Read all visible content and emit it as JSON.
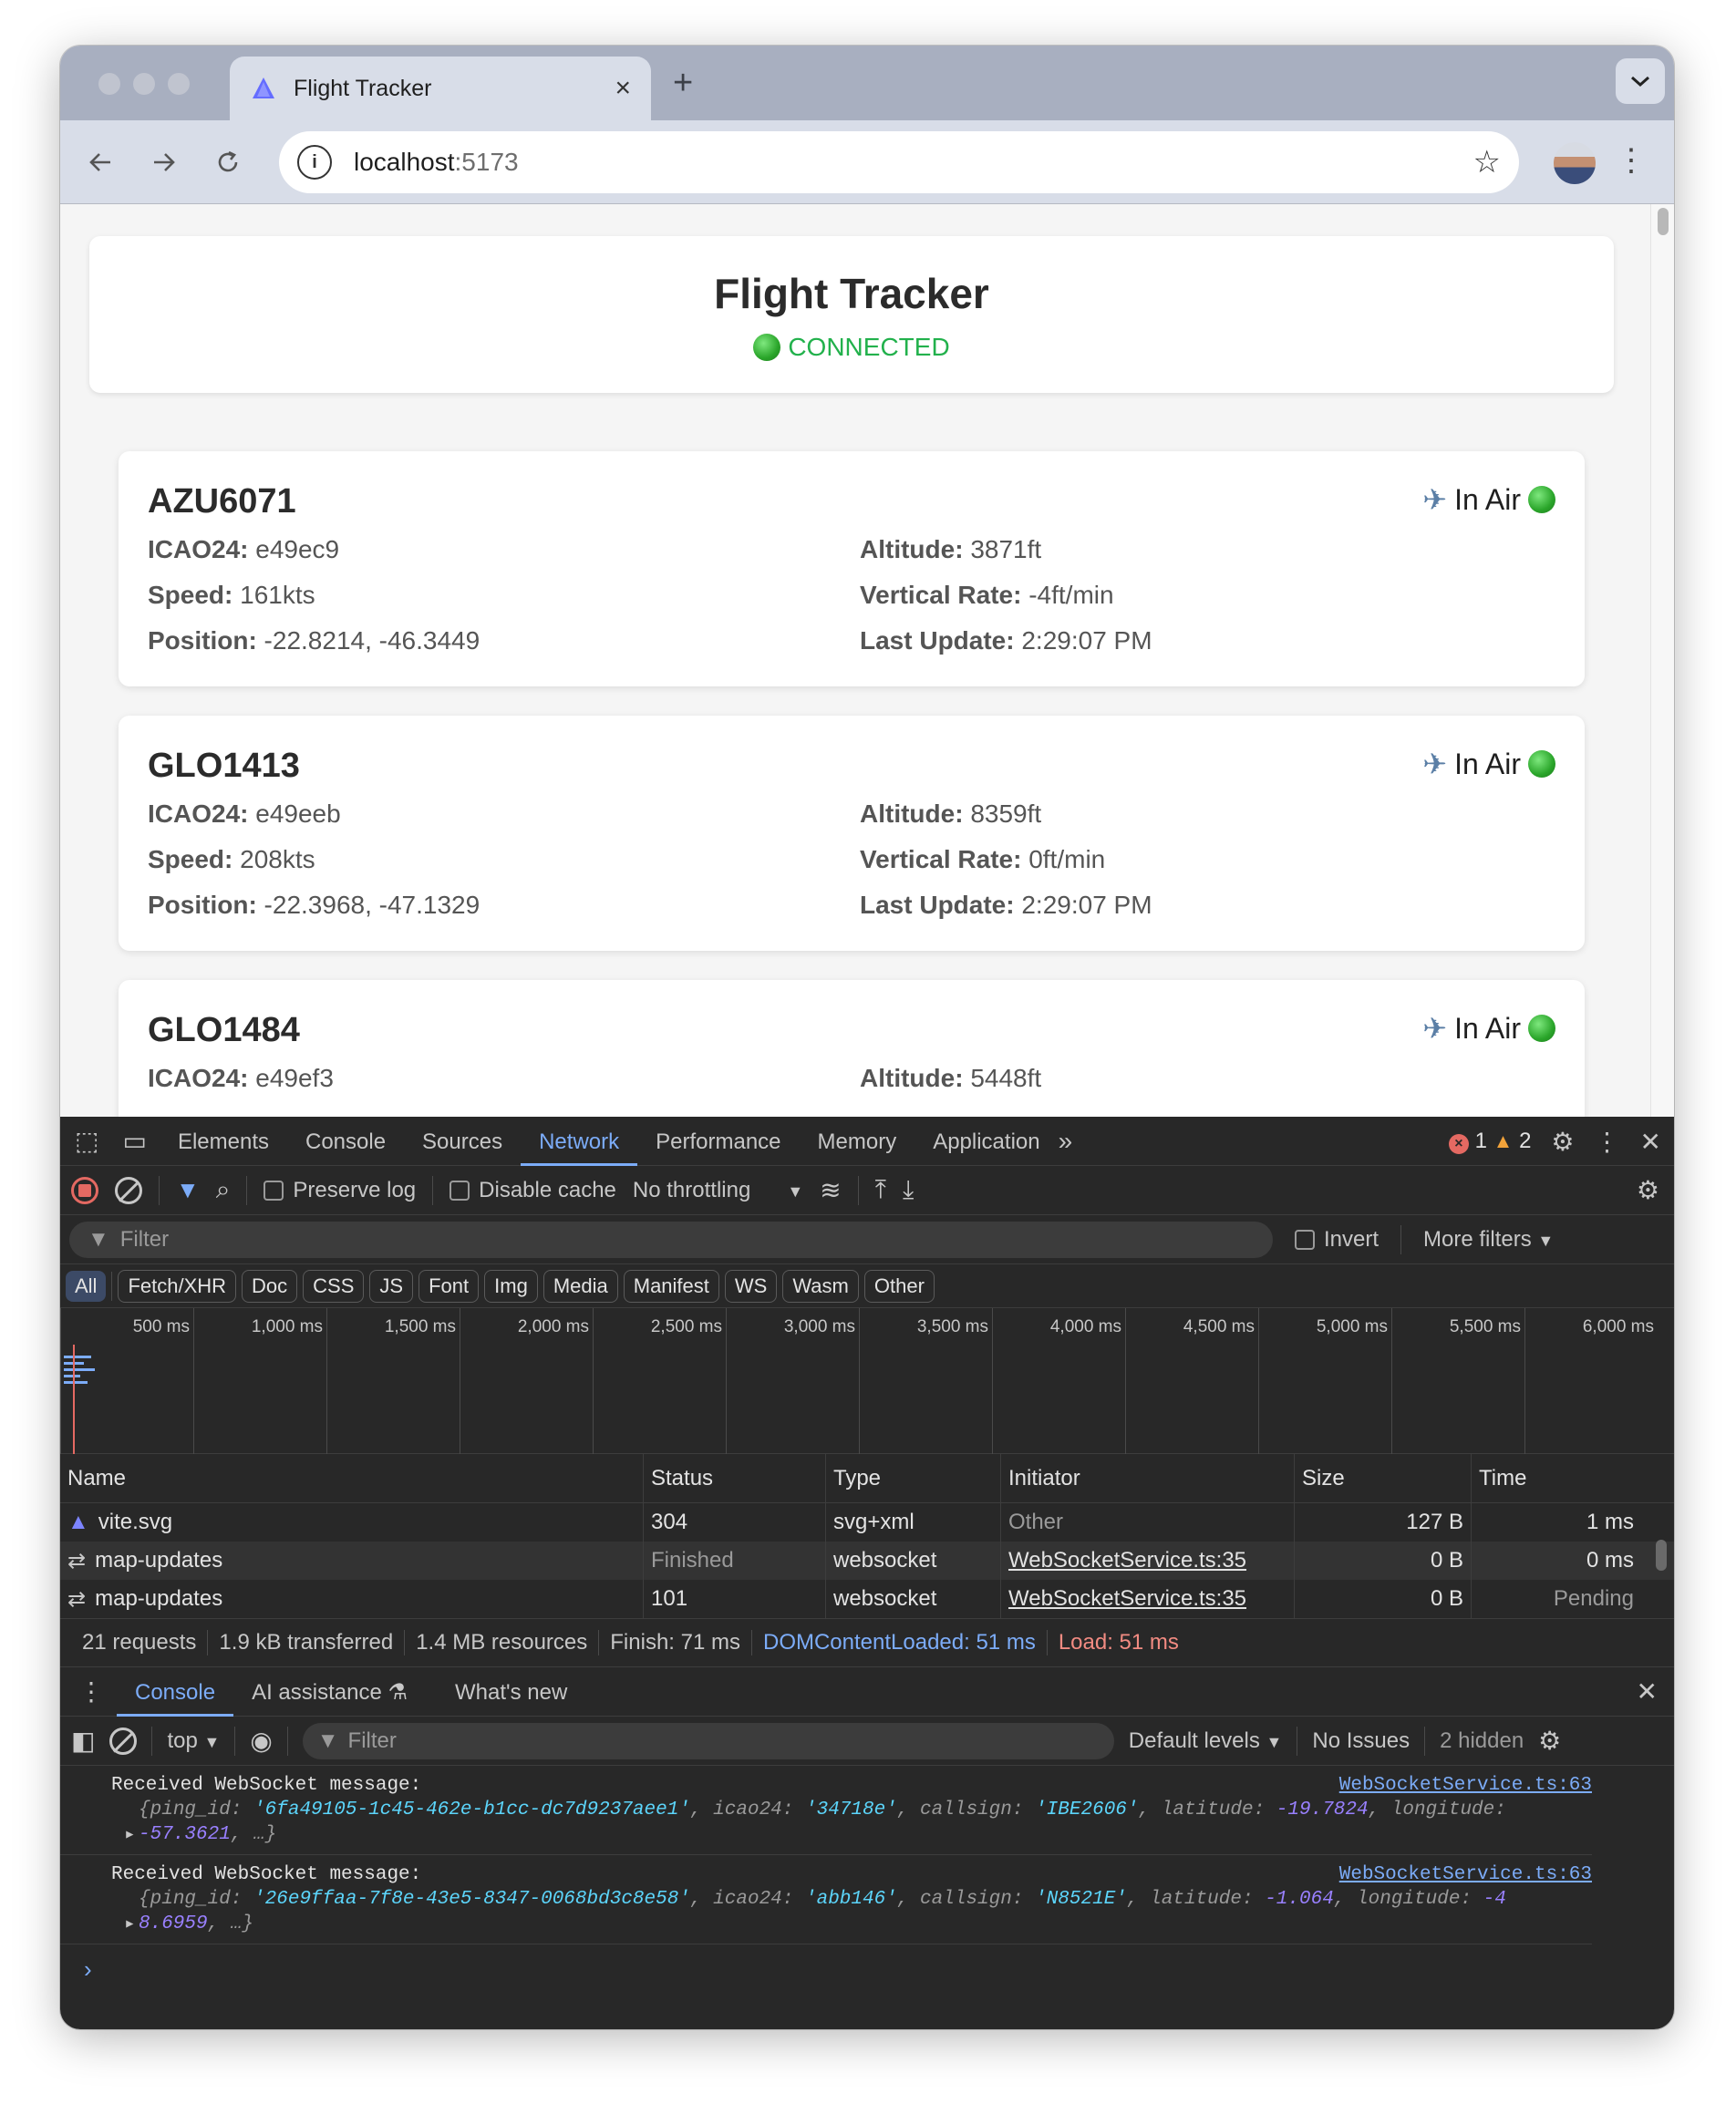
{
  "browser": {
    "tab_title": "Flight Tracker",
    "tab_close": "×",
    "new_tab": "+",
    "url_host": "localhost",
    "url_port": ":5173"
  },
  "app": {
    "title": "Flight Tracker",
    "status": "CONNECTED",
    "labels": {
      "icao24": "ICAO24:",
      "speed": "Speed:",
      "position": "Position:",
      "altitude": "Altitude:",
      "vrate": "Vertical Rate:",
      "last_update": "Last Update:"
    },
    "flights": [
      {
        "callsign": "AZU6071",
        "status": "In Air",
        "icao24": "e49ec9",
        "speed": "161kts",
        "position": "-22.8214, -46.3449",
        "altitude": "3871ft",
        "vrate": "-4ft/min",
        "last_update": "2:29:07 PM"
      },
      {
        "callsign": "GLO1413",
        "status": "In Air",
        "icao24": "e49eeb",
        "speed": "208kts",
        "position": "-22.3968, -47.1329",
        "altitude": "8359ft",
        "vrate": "0ft/min",
        "last_update": "2:29:07 PM"
      },
      {
        "callsign": "GLO1484",
        "status": "In Air",
        "icao24": "e49ef3",
        "altitude": "5448ft"
      }
    ]
  },
  "devtools": {
    "tabs": [
      "Elements",
      "Console",
      "Sources",
      "Network",
      "Performance",
      "Memory",
      "Application"
    ],
    "errors": "1",
    "warnings": "2",
    "preserve_log": "Preserve log",
    "disable_cache": "Disable cache",
    "throttling": "No throttling",
    "filter_placeholder": "Filter",
    "invert": "Invert",
    "more_filters": "More filters",
    "chips": [
      "All",
      "Fetch/XHR",
      "Doc",
      "CSS",
      "JS",
      "Font",
      "Img",
      "Media",
      "Manifest",
      "WS",
      "Wasm",
      "Other"
    ],
    "timeline_ticks": [
      "500 ms",
      "1,000 ms",
      "1,500 ms",
      "2,000 ms",
      "2,500 ms",
      "3,000 ms",
      "3,500 ms",
      "4,000 ms",
      "4,500 ms",
      "5,000 ms",
      "5,500 ms",
      "6,000 ms"
    ],
    "columns": [
      "Name",
      "Status",
      "Type",
      "Initiator",
      "Size",
      "Time"
    ],
    "rows": [
      {
        "name": "vite.svg",
        "status": "304",
        "type": "svg+xml",
        "initiator": "Other",
        "size": "127 B",
        "time": "1 ms"
      },
      {
        "name": "map-updates",
        "status": "Finished",
        "type": "websocket",
        "initiator": "WebSocketService.ts:35",
        "size": "0 B",
        "time": "0 ms"
      },
      {
        "name": "map-updates",
        "status": "101",
        "type": "websocket",
        "initiator": "WebSocketService.ts:35",
        "size": "0 B",
        "time": "Pending"
      }
    ],
    "summary": {
      "requests": "21 requests",
      "transferred": "1.9 kB transferred",
      "resources": "1.4 MB resources",
      "finish": "Finish: 71 ms",
      "dcl": "DOMContentLoaded: 51 ms",
      "load": "Load: 51 ms"
    },
    "drawer_tabs": [
      "Console",
      "AI assistance",
      "What's new"
    ],
    "console": {
      "context": "top",
      "filter_placeholder": "Filter",
      "levels": "Default levels",
      "issues": "No Issues",
      "hidden": "2 hidden",
      "messages": [
        {
          "text": "Received WebSocket message:",
          "source": "WebSocketService.ts:63",
          "ping_id": "'6fa49105-1c45-462e-b1cc-dc7d9237aee1'",
          "icao24": "'34718e'",
          "callsign": "'IBE2606'",
          "latitude": "-19.7824",
          "longitude_a": "",
          "longitude_b": "-57.3621"
        },
        {
          "text": "Received WebSocket message:",
          "source": "WebSocketService.ts:63",
          "ping_id": "'26e9ffaa-7f8e-43e5-8347-0068bd3c8e58'",
          "icao24": "'abb146'",
          "callsign": "'N8521E'",
          "latitude": "-1.064",
          "longitude_a": "-4",
          "longitude_b": "8.6959"
        }
      ]
    }
  }
}
